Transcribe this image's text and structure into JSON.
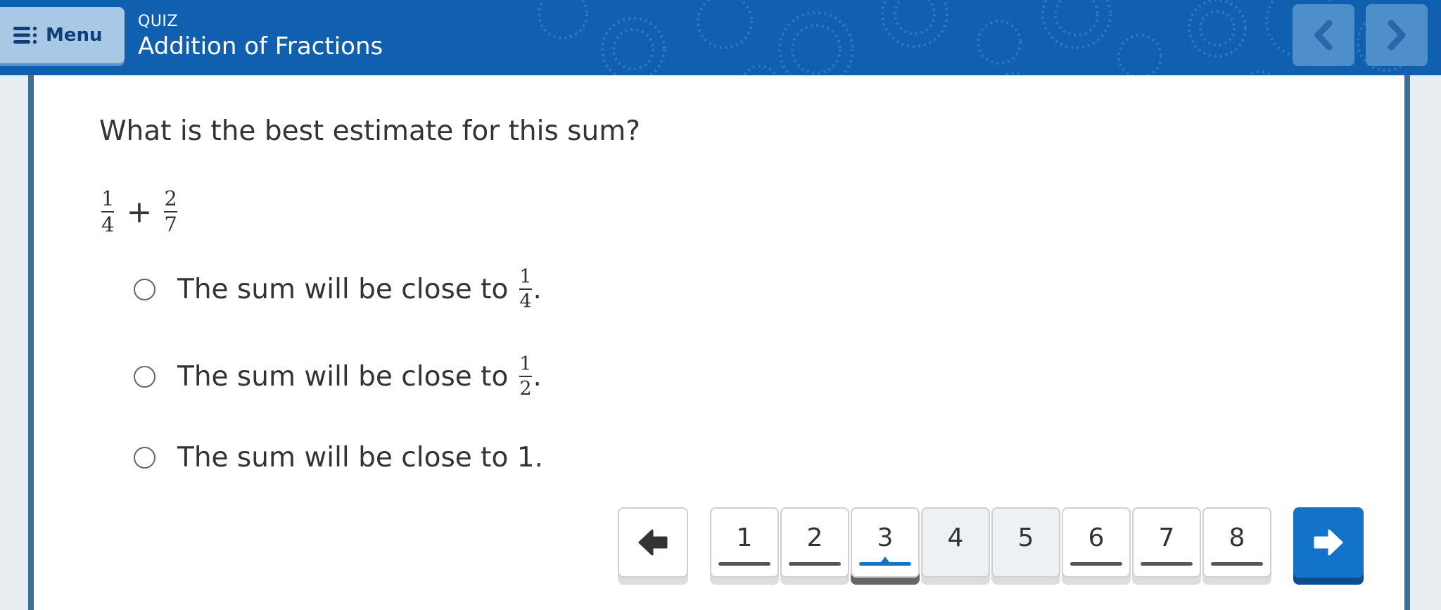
{
  "header": {
    "menu_label": "Menu",
    "kicker": "QUIZ",
    "title": "Addition of Fractions",
    "colors": {
      "bar": "#1160b0",
      "menu_button": "#a9c8e6",
      "nav_button": "#4e8ec9"
    }
  },
  "question": {
    "prompt": "What is the best estimate for this sum?",
    "expression": {
      "left": {
        "numerator": "1",
        "denominator": "4"
      },
      "operator": "+",
      "right": {
        "numerator": "2",
        "denominator": "7"
      }
    },
    "options": [
      {
        "text": "The sum will be close to",
        "fraction": {
          "numerator": "1",
          "denominator": "4"
        },
        "suffix": "."
      },
      {
        "text": "The sum will be close to",
        "fraction": {
          "numerator": "1",
          "denominator": "2"
        },
        "suffix": "."
      },
      {
        "text": "The sum will be close to 1."
      }
    ]
  },
  "pagination": {
    "pages": [
      {
        "label": "1",
        "state": "answered"
      },
      {
        "label": "2",
        "state": "answered"
      },
      {
        "label": "3",
        "state": "current"
      },
      {
        "label": "4",
        "state": "unanswered"
      },
      {
        "label": "5",
        "state": "unanswered"
      },
      {
        "label": "6",
        "state": "answered"
      },
      {
        "label": "7",
        "state": "answered"
      },
      {
        "label": "8",
        "state": "answered"
      }
    ],
    "current_page": 3,
    "colors": {
      "accent": "#1373c8"
    }
  },
  "icons": {
    "menu": "menu-list-icon",
    "header_prev": "chevron-left-icon",
    "header_next": "chevron-right-icon",
    "pager_back": "arrow-left-icon",
    "pager_next": "arrow-right-icon"
  }
}
